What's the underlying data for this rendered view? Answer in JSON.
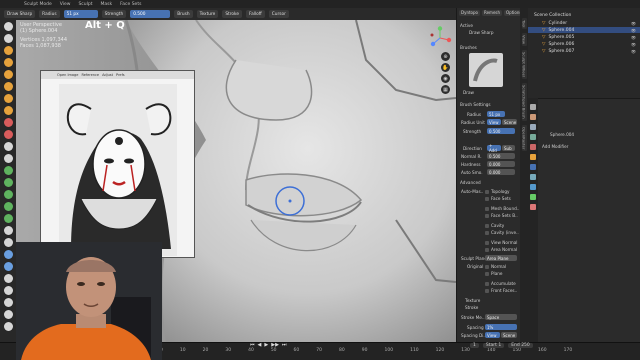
{
  "topbar": {
    "menus": [
      "Sculpt Mode",
      "View",
      "Sculpt",
      "Mask",
      "Face Sets"
    ]
  },
  "header": {
    "brush_name": "Draw Sharp",
    "radius_label": "Radius",
    "radius_value": "51 px",
    "strength_label": "Strength",
    "strength_value": "0.500",
    "menus": [
      "Brush",
      "Texture",
      "Stroke",
      "Falloff",
      "Cursor"
    ]
  },
  "viewport": {
    "perspective": "User Perspective",
    "object": "(1) Sphere.004",
    "vertices_label": "Vertices",
    "vertices_value": "1,097,344",
    "faces_label": "Faces",
    "faces_value": "1,087,938",
    "shortcut": "Alt + Q",
    "reference_tabs": [
      "Open Image",
      "Reference",
      "Adjust",
      "Prefs"
    ]
  },
  "properties": {
    "tabs": [
      "Dyntopo",
      "Remesh",
      "Options"
    ],
    "active_label": "Active",
    "active_brush": "Draw Sharp",
    "brushes_label": "Brushes",
    "brush_tile": "Draw",
    "brush_settings": "Brush Settings",
    "radius_label": "Radius",
    "radius_value": "51 px",
    "radius_unit_label": "Radius Unit",
    "view": "View",
    "scene": "Scene",
    "strength_label": "Strength",
    "strength_value": "0.500",
    "direction_label": "Direction",
    "add": "+ Add",
    "subtract": "Sub",
    "normal_radius_label": "Normal R.",
    "normal_radius_value": "0.500",
    "hardness_label": "Hardness",
    "hardness_value": "0.000",
    "auto_smooth_label": "Auto Smo.",
    "auto_smooth_value": "0.000",
    "advanced_label": "Advanced",
    "auto_masking_label": "Auto-Mas..",
    "auto_masking": [
      "Topology",
      "Face Sets",
      "Mesh Bound..",
      "Face Sets B..",
      "Cavity",
      "Cavity (inve.."
    ],
    "view_normal": "View Normal",
    "area_normal": "Area Normal",
    "sculpt_plane_label": "Sculpt Plane",
    "sculpt_plane_value": "Area Plane",
    "original_label": "Original",
    "original_normal": "Normal",
    "original_plane": "Plane",
    "accumulate": "Accumulate",
    "front_faces": "Front Faces..",
    "texture": "Texture",
    "stroke": "Stroke",
    "stroke_method_label": "Stroke Me..",
    "stroke_method_value": "Space",
    "spacing_label": "Spacing",
    "spacing_value": "1%",
    "spacing_dist_label": "Spacing Di..",
    "spacing_dist_view": "View",
    "spacing_dist_scene": "Scene"
  },
  "sidebar_tabs": [
    "Tool",
    "View",
    "Sculpt Wheel",
    "Scratchpad Brush",
    "OpenRaster"
  ],
  "outliner": {
    "title": "Scene Collection",
    "items": [
      {
        "name": "Cylinder",
        "selected": false
      },
      {
        "name": "Sphere.004",
        "selected": true
      },
      {
        "name": "Sphere.005",
        "selected": false
      },
      {
        "name": "Sphere.006",
        "selected": false
      },
      {
        "name": "Sphere.007",
        "selected": false
      }
    ]
  },
  "modifiers": {
    "object": "Sphere.004",
    "add_modifier": "Add Modifier"
  },
  "timeline": {
    "frames": [
      "0",
      "10",
      "20",
      "30",
      "40",
      "50",
      "60",
      "70",
      "80",
      "90",
      "100",
      "110",
      "120",
      "130",
      "140",
      "150",
      "160",
      "170"
    ],
    "start_label": "Start",
    "start_value": "1",
    "end_label": "End",
    "end_value": "250",
    "current_frame": "1"
  },
  "colors": {
    "accent": "#4772b3",
    "selection": "#334d80"
  }
}
